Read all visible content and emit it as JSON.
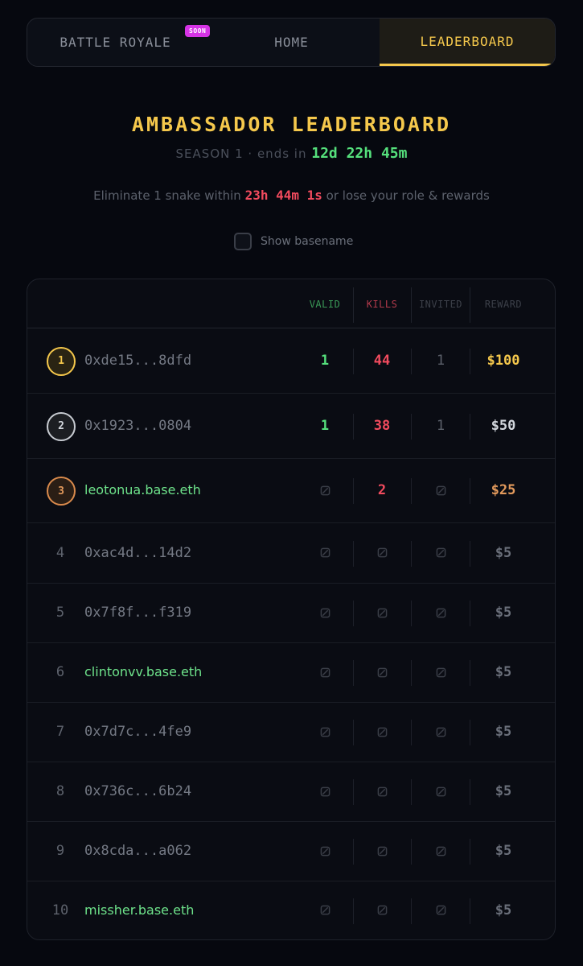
{
  "nav": {
    "tabs": [
      {
        "label": "BATTLE ROYALE",
        "badge": "SOON"
      },
      {
        "label": "HOME"
      },
      {
        "label": "LEADERBOARD",
        "active": true
      }
    ]
  },
  "header": {
    "title": "AMBASSADOR LEADERBOARD",
    "season_prefix": "SEASON 1 · ends in ",
    "season_timer": "12d 22h 45m",
    "warning_prefix": "Eliminate 1 snake within ",
    "warning_timer": "23h 44m 1s",
    "warning_suffix": " or lose your role & rewards",
    "toggle_label": "Show basename"
  },
  "table": {
    "columns": {
      "valid": "VALID",
      "kills": "KILLS",
      "invited": "INVITED",
      "reward": "REWARD"
    },
    "rows": [
      {
        "rank": "1",
        "address": "0xde15...8dfd",
        "basename": false,
        "valid": "1",
        "kills": "44",
        "invited": "1",
        "reward": "$100",
        "tier": "gold"
      },
      {
        "rank": "2",
        "address": "0x1923...0804",
        "basename": false,
        "valid": "1",
        "kills": "38",
        "invited": "1",
        "reward": "$50",
        "tier": "silver"
      },
      {
        "rank": "3",
        "address": "leotonua.base.eth",
        "basename": true,
        "valid": null,
        "kills": "2",
        "invited": null,
        "reward": "$25",
        "tier": "bronze"
      },
      {
        "rank": "4",
        "address": "0xac4d...14d2",
        "basename": false,
        "valid": null,
        "kills": null,
        "invited": null,
        "reward": "$5",
        "tier": "base"
      },
      {
        "rank": "5",
        "address": "0x7f8f...f319",
        "basename": false,
        "valid": null,
        "kills": null,
        "invited": null,
        "reward": "$5",
        "tier": "base"
      },
      {
        "rank": "6",
        "address": "clintonvv.base.eth",
        "basename": true,
        "valid": null,
        "kills": null,
        "invited": null,
        "reward": "$5",
        "tier": "base"
      },
      {
        "rank": "7",
        "address": "0x7d7c...4fe9",
        "basename": false,
        "valid": null,
        "kills": null,
        "invited": null,
        "reward": "$5",
        "tier": "base"
      },
      {
        "rank": "8",
        "address": "0x736c...6b24",
        "basename": false,
        "valid": null,
        "kills": null,
        "invited": null,
        "reward": "$5",
        "tier": "base"
      },
      {
        "rank": "9",
        "address": "0x8cda...a062",
        "basename": false,
        "valid": null,
        "kills": null,
        "invited": null,
        "reward": "$5",
        "tier": "base"
      },
      {
        "rank": "10",
        "address": "missher.base.eth",
        "basename": true,
        "valid": null,
        "kills": null,
        "invited": null,
        "reward": "$5",
        "tier": "base"
      }
    ]
  },
  "colors": {
    "accent": "#f5c84c",
    "valid": "#55e07c",
    "kills": "#f24b5e",
    "badge": "#d633e6",
    "background": "#06080f"
  },
  "icons": {
    "empty_cell": "slashed-square-icon"
  }
}
